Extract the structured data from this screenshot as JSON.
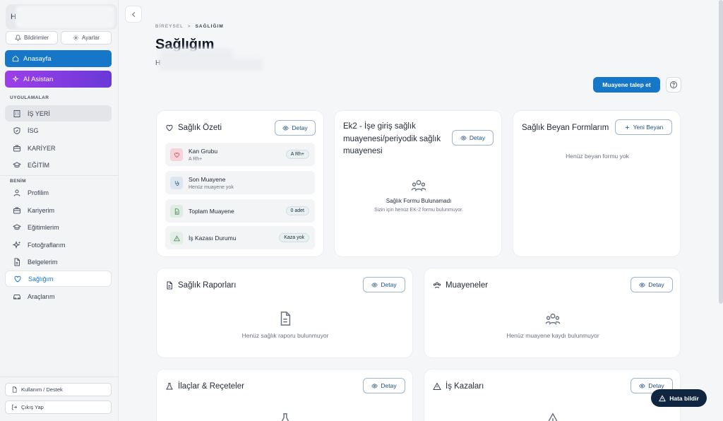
{
  "sidebar": {
    "profile_initial": "H",
    "notifications_label": "Bildirimler",
    "settings_label": "Ayarlar",
    "home_label": "Anasayfa",
    "ai_label": "AI Asistan",
    "apps_section": "UYGULAMALAR",
    "apps": [
      {
        "label": "İŞ YERİ",
        "icon": "building-icon"
      },
      {
        "label": "İSG",
        "icon": "shield-icon"
      },
      {
        "label": "KARİYER",
        "icon": "briefcase-icon"
      },
      {
        "label": "EĞİTİM",
        "icon": "graduation-cap-icon"
      }
    ],
    "mine_section": "BENİM",
    "mine": [
      {
        "label": "Profilim",
        "icon": "user-icon"
      },
      {
        "label": "Kariyerim",
        "icon": "briefcase-icon"
      },
      {
        "label": "Eğitimlerim",
        "icon": "graduation-cap-icon"
      },
      {
        "label": "Fotoğraflarım",
        "icon": "sparkle-icon"
      },
      {
        "label": "Belgelerim",
        "icon": "document-icon"
      },
      {
        "label": "Sağlığım",
        "icon": "heart-icon"
      },
      {
        "label": "Araçlarım",
        "icon": "car-icon"
      }
    ],
    "support_label": "Kullanım / Destek",
    "logout_label": "Çıkış Yap"
  },
  "breadcrumb": {
    "parent": "BİREYSEL",
    "separator": ">",
    "current": "SAĞLIĞIM"
  },
  "page": {
    "title": "Sağlığım",
    "subtitle_initial": "H"
  },
  "actions": {
    "request_exam": "Muayene talep et"
  },
  "colors": {
    "primary": "#1677c9",
    "ai_gradient_start": "#9b3fe8",
    "ai_gradient_end": "#6a38d8",
    "report_button": "#0f2540"
  },
  "summary": {
    "title": "Sağlık Özeti",
    "detail": "Detay",
    "rows": [
      {
        "label": "Kan Grubu",
        "sub": "A Rh+",
        "badge": "A Rh+",
        "icon": "heart-icon"
      },
      {
        "label": "Son Muayene",
        "sub": "Henüz muayene yok",
        "badge": "",
        "icon": "stethoscope-icon"
      },
      {
        "label": "Toplam Muayene",
        "sub": "",
        "badge": "0 adet",
        "icon": "document-icon"
      },
      {
        "label": "İş Kazası Durumu",
        "sub": "",
        "badge": "Kaza yok",
        "icon": "warning-icon"
      }
    ]
  },
  "ek2": {
    "title_line1": "Ek2 - İşe giriş sağlık",
    "title_line2": "muayenesi/periyodik sağlık",
    "title_line3": "muayenesi",
    "detail": "Detay",
    "empty_title": "Sağlık Formu Bulunamadı",
    "empty_text": "Sizin için henüz EK-2 formu bulunmuyor."
  },
  "declarations": {
    "title": "Sağlık Beyan Formlarım",
    "new": "Yeni Beyan",
    "empty_text": "Henüz beyan formu yok"
  },
  "reports": {
    "title": "Sağlık Raporları",
    "detail": "Detay",
    "empty_text": "Henüz sağlık raporu bulunmuyor"
  },
  "exams": {
    "title": "Muayeneler",
    "detail": "Detay",
    "empty_text": "Henüz muayene kaydı bulunmuyor"
  },
  "medicines": {
    "title": "İlaçlar & Reçeteler",
    "detail": "Detay"
  },
  "accidents": {
    "title": "İş Kazaları",
    "detail": "Detay"
  },
  "report_bug": "Hata bildir"
}
